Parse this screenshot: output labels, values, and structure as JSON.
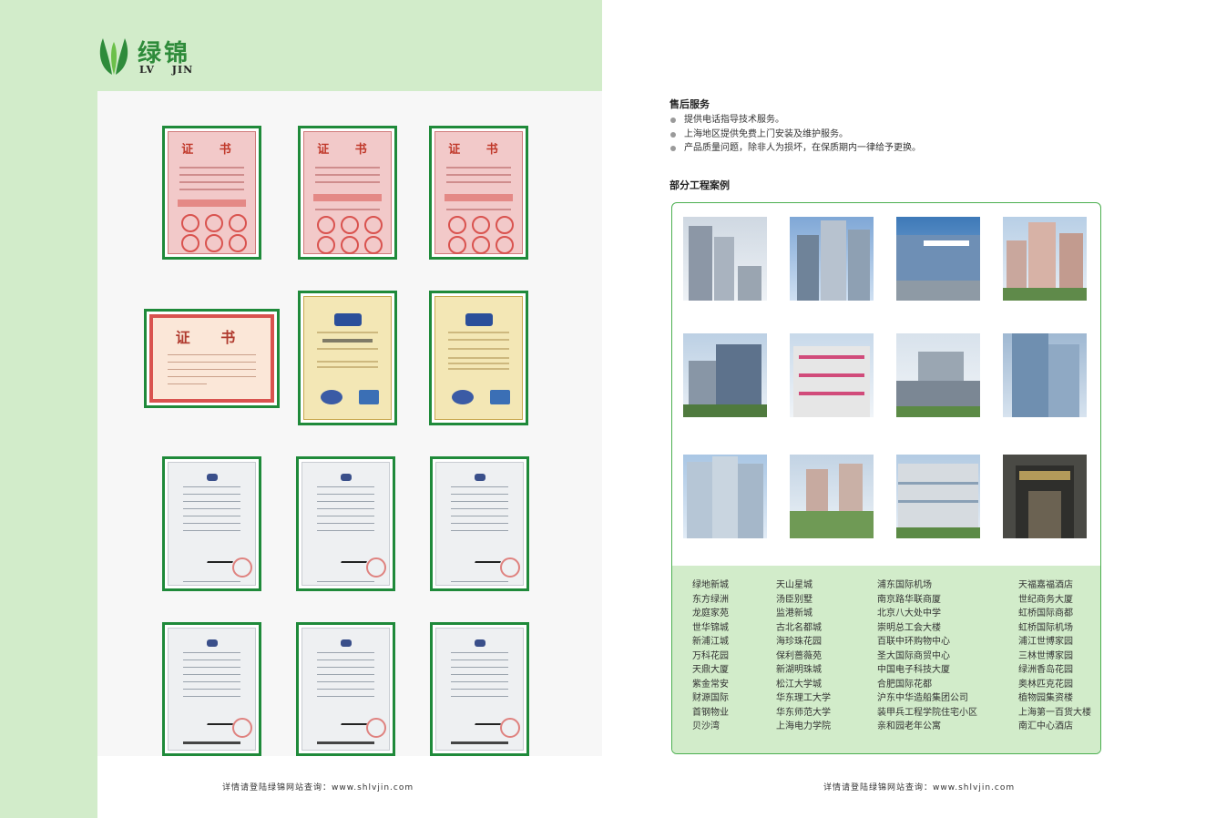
{
  "logo": {
    "cn": "绿锦",
    "en": "LV JIN"
  },
  "colors": {
    "brand_green": "#1f8a3a",
    "panel_green": "#d2ecca",
    "box_border": "#4caf50"
  },
  "after_sales": {
    "title": "售后服务",
    "items": [
      "提供电话指导技术服务。",
      "上海地区提供免费上门安装及维护服务。",
      "产品质量问题，除非人为损坏，在保质期内一律给予更换。"
    ]
  },
  "projects": {
    "title": "部分工程案例",
    "columns": [
      [
        "绿地新城",
        "东方绿洲",
        "龙庭家苑",
        "世华锦城",
        "新浦江城",
        "万科花园",
        "天鼎大厦",
        "紫金常安",
        "财源国际",
        "首钢物业",
        "贝沙湾"
      ],
      [
        "天山星城",
        "汤臣别墅",
        "监港新城",
        "古北名都城",
        "海珍珠花园",
        "保利蔷薇苑",
        "新湖明珠城",
        "松江大学城",
        "华东理工大学",
        "华东师范大学",
        "上海电力学院"
      ],
      [
        "浦东国际机场",
        "南京路华联商厦",
        "北京八大处中学",
        "崇明总工会大楼",
        "百联中环购物中心",
        "圣大国际商贸中心",
        "中国电子科技大厦",
        "合肥国际花都",
        "沪东中华造船集团公司",
        "装甲兵工程学院住宅小区",
        "亲和园老年公寓"
      ],
      [
        "天福嘉福酒店",
        "世纪商务大厦",
        "虹桥国际商都",
        "虹桥国际机场",
        "浦江世博家园",
        "三林世博家园",
        "绿洲香岛花园",
        "奥林匹克花园",
        "植物园集资楼",
        "上海第一百货大楼",
        "南汇中心酒店"
      ]
    ]
  },
  "footer": {
    "left": "详情请登陆绿锦网站查询：www.shlvjin.com",
    "right": "详情请登陆绿锦网站查询：www.shlvjin.com"
  },
  "certificates": {
    "pink_title": "证 书",
    "red_title": "证 书"
  }
}
